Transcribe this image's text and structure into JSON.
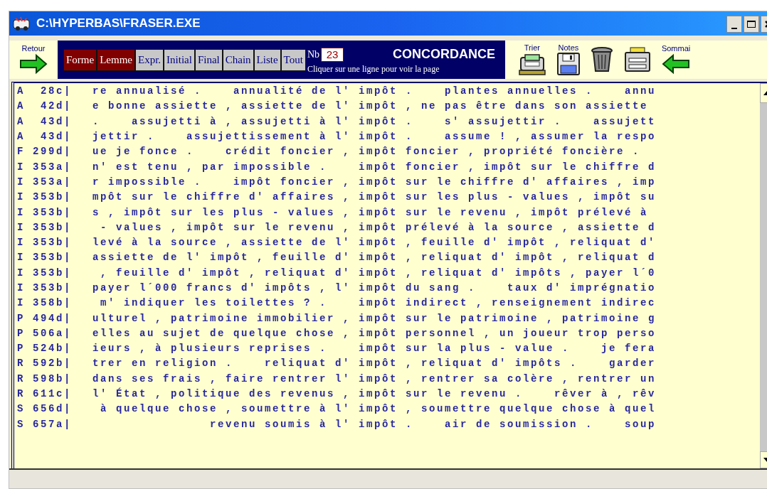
{
  "window": {
    "title": "C:\\HYPERBAS\\FRASER.EXE"
  },
  "toolbar": {
    "back_label": "Retour",
    "tabs": [
      {
        "label": "Forme",
        "selected": true
      },
      {
        "label": "Lemme",
        "selected": true
      },
      {
        "label": "Expr.",
        "selected": false
      },
      {
        "label": "Initial",
        "selected": false
      },
      {
        "label": "Final",
        "selected": false
      },
      {
        "label": "Chain",
        "selected": false
      },
      {
        "label": "Liste",
        "selected": false
      },
      {
        "label": "Tout",
        "selected": false
      }
    ],
    "count_label": "Nb",
    "count": "23",
    "title": "CONCORDANCE",
    "hint": "Cliquer sur une ligne pour voir la page",
    "tools": [
      {
        "kind": "sort",
        "label": "Trier"
      },
      {
        "kind": "notes",
        "label": "Notes"
      },
      {
        "kind": "trash"
      },
      {
        "kind": "print"
      },
      {
        "kind": "summary",
        "label": "Sommai"
      }
    ]
  },
  "lines": [
    {
      "ref": "A  28c|",
      "context": "re annualisé .    annualité de l' impôt .    plantes annuelles .    annu"
    },
    {
      "ref": "A  42d|",
      "context": "e bonne assiette , assiette de l' impôt , ne pas être dans son assiette"
    },
    {
      "ref": "A  43d|",
      "context": ".    assujetti à , assujetti à l' impôt .    s' assujettir .    assujett"
    },
    {
      "ref": "A  43d|",
      "context": "jettir .    assujettissement à l' impôt .    assume ! , assumer la respo"
    },
    {
      "ref": "F 299d|",
      "context": "ue je fonce .    crédit foncier , impôt foncier , propriété foncière ."
    },
    {
      "ref": "I 353a|",
      "context": "n' est tenu , par impossible .    impôt foncier , impôt sur le chiffre d"
    },
    {
      "ref": "I 353a|",
      "context": "r impossible .    impôt foncier , impôt sur le chiffre d' affaires , imp"
    },
    {
      "ref": "I 353b|",
      "context": "mpôt sur le chiffre d' affaires , impôt sur les plus - values , impôt su"
    },
    {
      "ref": "I 353b|",
      "context": "s , impôt sur les plus - values , impôt sur le revenu , impôt prélevé à"
    },
    {
      "ref": "I 353b|",
      "context": " - values , impôt sur le revenu , impôt prélevé à la source , assiette d"
    },
    {
      "ref": "I 353b|",
      "context": "levé à la source , assiette de l' impôt , feuille d' impôt , reliquat d'"
    },
    {
      "ref": "I 353b|",
      "context": "assiette de l' impôt , feuille d' impôt , reliquat d' impôt , reliquat d"
    },
    {
      "ref": "I 353b|",
      "context": " , feuille d' impôt , reliquat d' impôt , reliquat d' impôts , payer l´0"
    },
    {
      "ref": "I 353b|",
      "context": "payer l´000 francs d' impôts , l' impôt du sang .    taux d' imprégnatio"
    },
    {
      "ref": "I 358b|",
      "context": " m' indiquer les toilettes ? .    impôt indirect , renseignement indirec"
    },
    {
      "ref": "P 494d|",
      "context": "ulturel , patrimoine immobilier , impôt sur le patrimoine , patrimoine g"
    },
    {
      "ref": "P 506a|",
      "context": "elles au sujet de quelque chose , impôt personnel , un joueur trop perso"
    },
    {
      "ref": "P 524b|",
      "context": "ieurs , à plusieurs reprises .    impôt sur la plus - value .    je fera"
    },
    {
      "ref": "R 592b|",
      "context": "trer en religion .    reliquat d' impôt , reliquat d' impôts .    garder"
    },
    {
      "ref": "R 598b|",
      "context": "dans ses frais , faire rentrer l' impôt , rentrer sa colère , rentrer un"
    },
    {
      "ref": "R 611c|",
      "context": "l' État , politique des revenus , impôt sur le revenu .    rêver à , rêv"
    },
    {
      "ref": "S 656d|",
      "context": " à quelque chose , soumettre à l' impôt , soumettre quelque chose à quel"
    },
    {
      "ref": "S 657a|",
      "context": "               revenu soumis à l' impôt .    air de soumission .    soup"
    }
  ]
}
